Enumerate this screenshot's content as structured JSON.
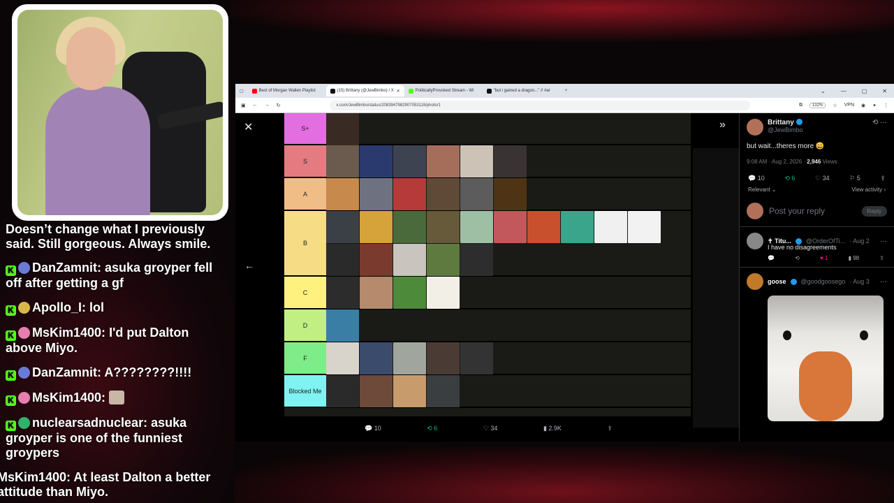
{
  "chat": {
    "lines": [
      {
        "user": "",
        "text": "Doesn’t change what I previously said. Still gorgeous. Always smile."
      },
      {
        "user": "DanZamnit:",
        "text": "asuka groyper fell off after getting a gf"
      },
      {
        "user": "Apollo_I:",
        "text": "lol"
      },
      {
        "user": "MsKim1400:",
        "text": "I'd put Dalton above Miyo."
      },
      {
        "user": "DanZamnit:",
        "text": "A????????!!!!"
      },
      {
        "user": "MsKim1400:",
        "text": ""
      },
      {
        "user": "nuclearsadnuclear:",
        "text": "asuka groyper is one of the funniest groypers"
      },
      {
        "user": "MsKim1400:",
        "text": "At least Dalton a better attitude than Miyo."
      }
    ]
  },
  "browser": {
    "tabs": [
      {
        "label": "Best of Morgan Wallen Playlist",
        "color": "#ff0000"
      },
      {
        "label": "(15) Brittany (@JewBimbo) / X",
        "color": "#111111"
      },
      {
        "label": "PoliticallyProvoked Stream - Wi",
        "color": "#53fc18"
      },
      {
        "label": "\"but i gained a dragon...\" // #ar",
        "color": "#111111"
      }
    ],
    "url": "x.com/JewBimbo/status/2083947982907053119/photo/1",
    "zoom": "132%",
    "vpn": "VPN"
  },
  "tierlist": {
    "tiers": [
      {
        "label": "S+",
        "color": "#e36ee0",
        "items": [
          "#3a2a24"
        ]
      },
      {
        "label": "S",
        "color": "#e47b80",
        "items": [
          "#6b5b4e",
          "#2a3a6e",
          "#3e4352",
          "#a56e5b",
          "#ccc3b6",
          "#3a3333"
        ]
      },
      {
        "label": "A",
        "color": "#f1bd86",
        "items": [
          "#c7894c",
          "#6e7280",
          "#b63a3a",
          "#5e4a36",
          "#5c5c5c",
          "#4e3415"
        ]
      },
      {
        "label": "B",
        "color": "#f6dc84",
        "items": [
          "#3b4046",
          "#d6a23a",
          "#4b6a3c",
          "#665a3a",
          "#9fbfa4",
          "#c2585b",
          "#c9502d",
          "#3aa58a",
          "#f0f0f0",
          "#f2f2f2",
          "#2a2a2a",
          "#7a3a2e",
          "#c9c4bd",
          "#5f7a3f",
          "#2d2d2d"
        ]
      },
      {
        "label": "C",
        "color": "#fef17f",
        "items": [
          "#2c2c2c",
          "#b58a6d",
          "#4d8a3a",
          "#f2f0e6"
        ]
      },
      {
        "label": "D",
        "color": "#c1ef82",
        "items": [
          "#3a7ea6"
        ]
      },
      {
        "label": "F",
        "color": "#7eec88",
        "items": [
          "#d8d4cc",
          "#3b4b6c",
          "#a0a69e",
          "#4a3c34",
          "#333333"
        ]
      },
      {
        "label": "Blocked Me",
        "color": "#7ef3f1",
        "items": [
          "#2a2a2a",
          "#6d4a3a",
          "#c79b6c",
          "#3a3e40"
        ]
      }
    ]
  },
  "tweet_actions": {
    "replies": "10",
    "reposts": "6",
    "likes": "34",
    "views": "2.9K"
  },
  "side": {
    "name": "Brittany",
    "handle": "@JewBimbo",
    "text": "but wait...theres more 😄",
    "time": "9:08 AM · Aug 2, 2026 ·",
    "views": "2,946",
    "views_label": "Views",
    "replies": "10",
    "reposts": "6",
    "likes": "34",
    "bookmarks": "5",
    "relevant": "Relevant",
    "view_activity": "View activity",
    "reply_placeholder": "Post your reply",
    "reply_button": "Reply",
    "reply1": {
      "name": "✝ Titu...",
      "handle": "@OrderOfTi...",
      "date": "· Aug 2",
      "text": "I have no disagreements",
      "likes": "1",
      "views": "98"
    },
    "reply2": {
      "name": "goose",
      "handle": "@goodgoosego",
      "date": "· Aug 3"
    }
  },
  "colors": {
    "accent": "#1d9bf0",
    "repost": "#00ba7c",
    "like": "#f91880",
    "kick": "#53fc18"
  }
}
